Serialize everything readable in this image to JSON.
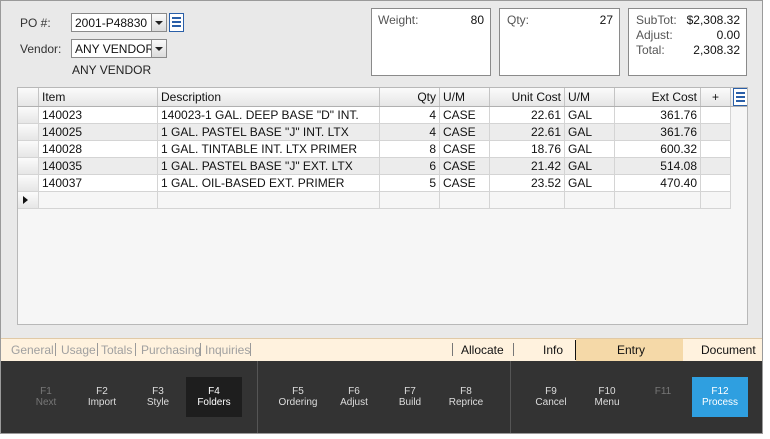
{
  "header": {
    "po_label": "PO #:",
    "po_value": "2001-P48830",
    "vendor_label": "Vendor:",
    "vendor_value": "ANY VENDOR",
    "vendor_name": "ANY VENDOR"
  },
  "summary": {
    "weight_label": "Weight:",
    "weight_value": "80",
    "qty_label": "Qty:",
    "qty_value": "27",
    "subtot_label": "SubTot:",
    "subtot_value": "$2,308.32",
    "adjust_label": "Adjust:",
    "adjust_value": "0.00",
    "total_label": "Total:",
    "total_value": "2,308.32"
  },
  "grid": {
    "columns": [
      "Item",
      "Description",
      "Qty",
      "U/M",
      "Unit Cost",
      "U/M",
      "Ext Cost",
      "+"
    ],
    "rows": [
      [
        "140023",
        "140023-1 GAL. DEEP BASE \"D\" INT.",
        "4",
        "CASE",
        "22.61",
        "GAL",
        "361.76"
      ],
      [
        "140025",
        "1 GAL. PASTEL BASE \"J\" INT. LTX",
        "4",
        "CASE",
        "22.61",
        "GAL",
        "361.76"
      ],
      [
        "140028",
        "1 GAL. TINTABLE INT. LTX PRIMER",
        "8",
        "CASE",
        "18.76",
        "GAL",
        "600.32"
      ],
      [
        "140035",
        "1 GAL. PASTEL BASE \"J\" EXT. LTX",
        "6",
        "CASE",
        "21.42",
        "GAL",
        "514.08"
      ],
      [
        "140037",
        "1 GAL. OIL-BASED EXT. PRIMER",
        "5",
        "CASE",
        "23.52",
        "GAL",
        "470.40"
      ]
    ]
  },
  "tabs": {
    "left": [
      "General",
      "Usage",
      "Totals",
      "Purchasing",
      "Inquiries"
    ],
    "allocate": "Allocate",
    "info": "Info",
    "entry": "Entry",
    "document": "Document"
  },
  "fkeys": [
    {
      "key": "F1",
      "name": "Next"
    },
    {
      "key": "F2",
      "name": "Import"
    },
    {
      "key": "F3",
      "name": "Style"
    },
    {
      "key": "F4",
      "name": "Folders"
    },
    {
      "key": "F5",
      "name": "Ordering"
    },
    {
      "key": "F6",
      "name": "Adjust"
    },
    {
      "key": "F7",
      "name": "Build"
    },
    {
      "key": "F8",
      "name": "Reprice"
    },
    {
      "key": "F9",
      "name": "Cancel"
    },
    {
      "key": "F10",
      "name": "Menu"
    },
    {
      "key": "F11",
      "name": ""
    },
    {
      "key": "F12",
      "name": "Process"
    }
  ],
  "colors": {
    "accent": "#2f9fe0",
    "tab_active_bg": "#f5d9a8",
    "fkey_bar": "#333333"
  }
}
